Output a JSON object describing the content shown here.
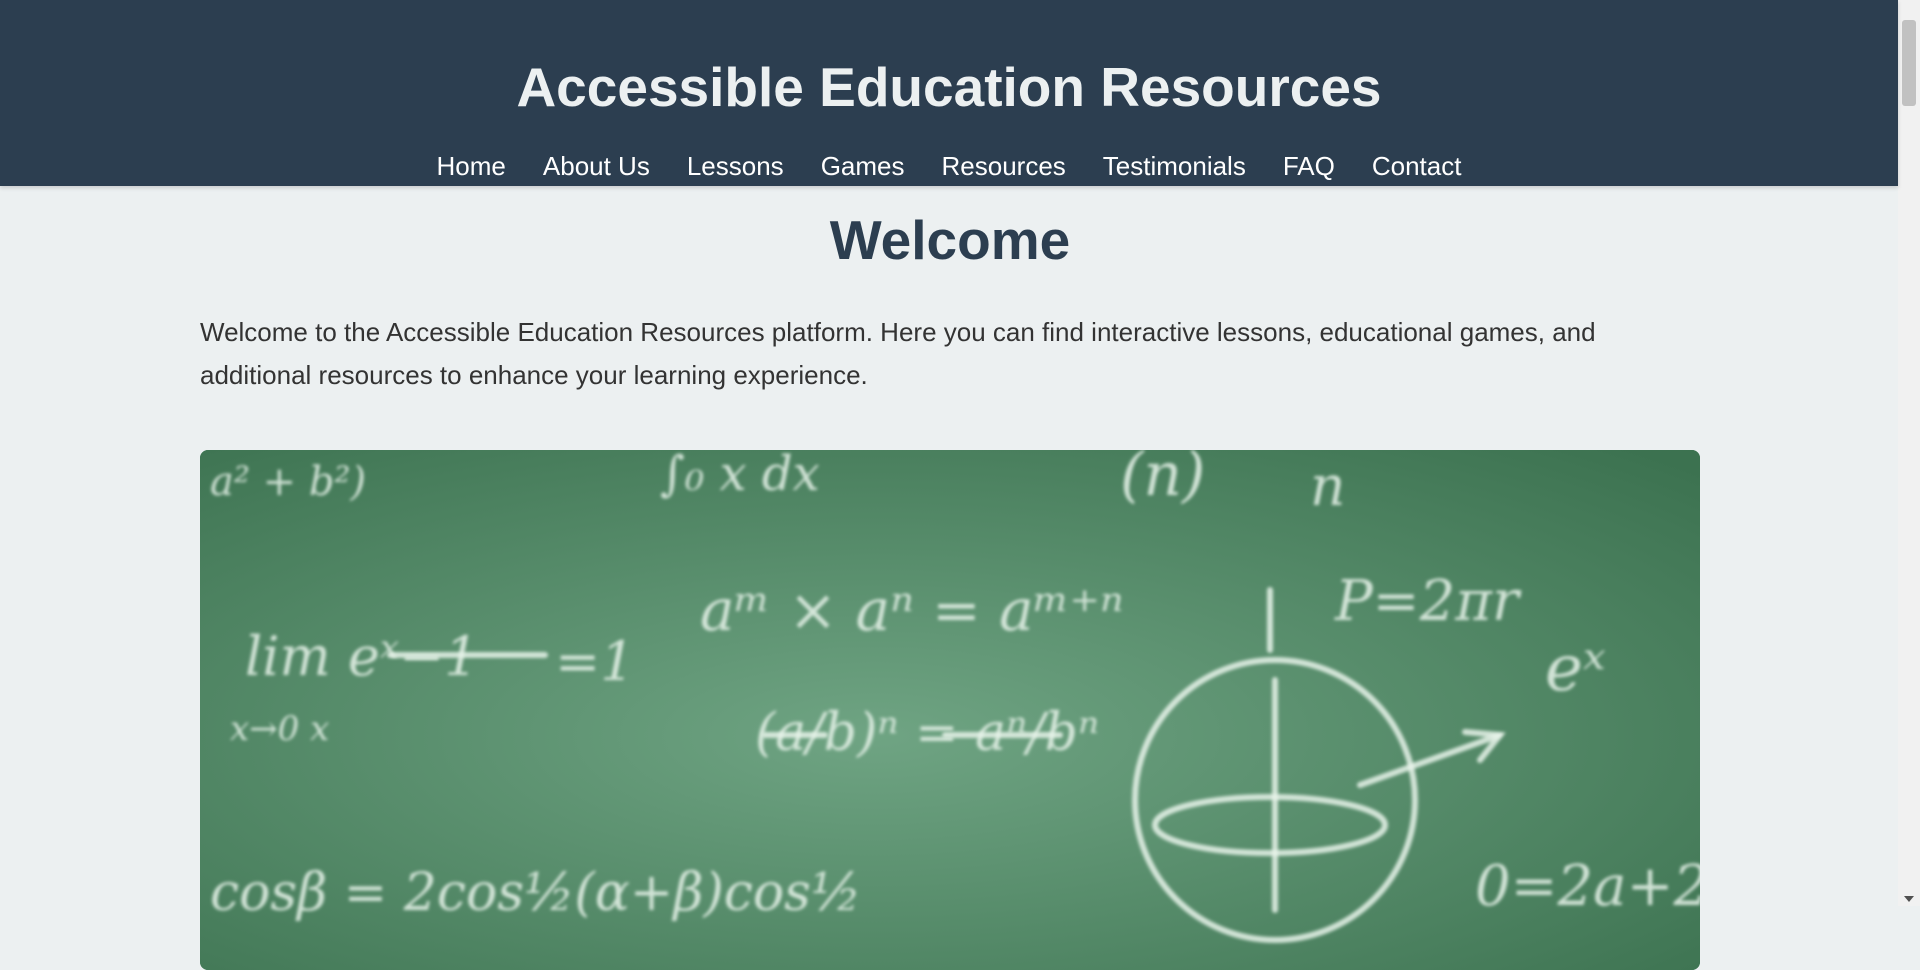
{
  "header": {
    "title": "Accessible Education Resources",
    "nav": [
      "Home",
      "About Us",
      "Lessons",
      "Games",
      "Resources",
      "Testimonials",
      "FAQ",
      "Contact"
    ]
  },
  "main": {
    "heading": "Welcome",
    "intro": "Welcome to the Accessible Education Resources platform. Here you can find interactive lessons, educational games, and additional resources to enhance your learning experience."
  },
  "image": {
    "formulas": [
      "a² + b²)",
      "∫₀ x dx",
      "(n)",
      "n",
      "lim eˣ−1",
      "x→0  x",
      "=1",
      "aᵐ × aⁿ = aᵐ⁺ⁿ",
      "(a/b)ⁿ = aⁿ/bⁿ",
      "P=2πr",
      "eˣ",
      "cosβ = 2cos½(α+β)cos½",
      "0=2a+2"
    ],
    "colors": {
      "board_dark": "#3c7250",
      "board_light": "#6fa483",
      "chalk": "#e8f3ea"
    }
  },
  "colors": {
    "header_bg": "#2c3e50",
    "page_bg": "#ecf0f1",
    "header_text": "#ecf0f1",
    "heading": "#2c3e50"
  }
}
